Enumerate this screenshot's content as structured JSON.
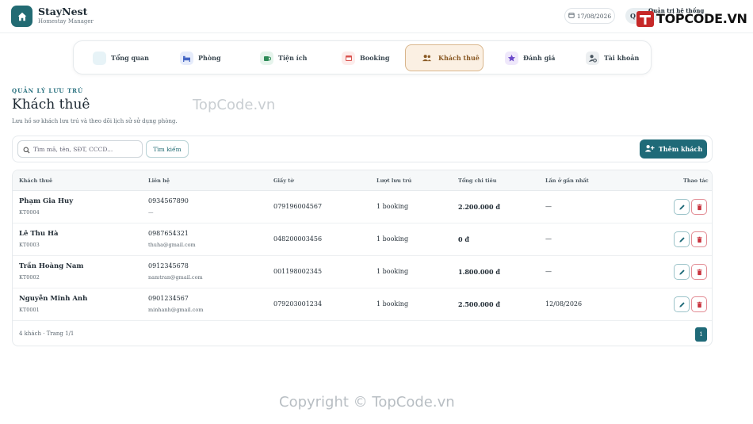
{
  "app": {
    "name": "StayNest",
    "subtitle": "Homestay Manager",
    "date": "17/08/2026",
    "admin_initial": "Q",
    "admin_role": "Quản trị hệ thống",
    "brand_color": "#226b73"
  },
  "watermark": {
    "logo_text": "TOPCODE.VN",
    "center_text": "TopCode.vn",
    "footer_text": "Copyright © TopCode.vn"
  },
  "nav": {
    "items": [
      {
        "label": "Tổng quan",
        "icon": "dashboard-icon"
      },
      {
        "label": "Phòng",
        "icon": "bed-icon"
      },
      {
        "label": "Tiện ích",
        "icon": "coffee-icon"
      },
      {
        "label": "Booking",
        "icon": "calendar-icon"
      },
      {
        "label": "Khách thuê",
        "icon": "users-icon",
        "active": true
      },
      {
        "label": "Đánh giá",
        "icon": "star-icon"
      },
      {
        "label": "Tài khoản",
        "icon": "user-gear-icon"
      }
    ]
  },
  "page": {
    "eyebrow": "QUẢN LÝ LƯU TRÚ",
    "title": "Khách thuê",
    "description": "Lưu hồ sơ khách lưu trú và theo dõi lịch sử sử dụng phòng."
  },
  "search": {
    "placeholder": "Tìm mã, tên, SĐT, CCCD...",
    "button_label": "Tìm kiếm",
    "add_label": "Thêm khách"
  },
  "table": {
    "headers": [
      "Khách thuê",
      "Liên hệ",
      "Giấy tờ",
      "Lượt lưu trú",
      "Tổng chi tiêu",
      "Lần ở gần nhất",
      "Thao tác"
    ],
    "rows": [
      {
        "name": "Phạm Gia Huy",
        "code": "KT0004",
        "phone": "0934567890",
        "email": "—",
        "id_doc": "079196004567",
        "stays": "1 booking",
        "total": "2.200.000 đ",
        "last_stay": "—"
      },
      {
        "name": "Lê Thu Hà",
        "code": "KT0003",
        "phone": "0987654321",
        "email": "thuha@gmail.com",
        "id_doc": "048200003456",
        "stays": "1 booking",
        "total": "0 đ",
        "last_stay": "—"
      },
      {
        "name": "Trần Hoàng Nam",
        "code": "KT0002",
        "phone": "0912345678",
        "email": "namtran@gmail.com",
        "id_doc": "001198002345",
        "stays": "1 booking",
        "total": "1.800.000 đ",
        "last_stay": "—"
      },
      {
        "name": "Nguyễn Minh Anh",
        "code": "KT0001",
        "phone": "0901234567",
        "email": "minhanh@gmail.com",
        "id_doc": "079203001234",
        "stays": "1 booking",
        "total": "2.500.000 đ",
        "last_stay": "12/08/2026"
      }
    ]
  },
  "pagination": {
    "summary": "4 khách · Trang 1/1",
    "current_page": "1"
  }
}
